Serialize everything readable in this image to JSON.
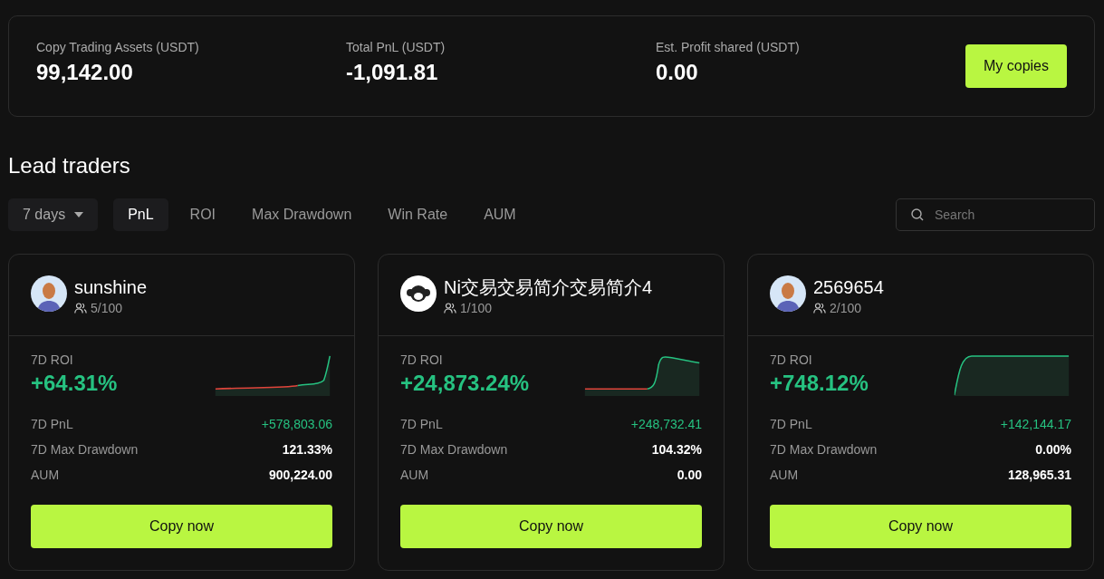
{
  "summary": {
    "stats": [
      {
        "label": "Copy Trading Assets (USDT)",
        "value": "99,142.00"
      },
      {
        "label": "Total PnL (USDT)",
        "value": "-1,091.81"
      },
      {
        "label": "Est. Profit shared (USDT)",
        "value": "0.00"
      }
    ],
    "button": "My copies"
  },
  "section_title": "Lead traders",
  "period": "7 days",
  "tabs": [
    {
      "label": "PnL",
      "selected": true
    },
    {
      "label": "ROI",
      "selected": false
    },
    {
      "label": "Max Drawdown",
      "selected": false
    },
    {
      "label": "Win Rate",
      "selected": false
    },
    {
      "label": "AUM",
      "selected": false
    }
  ],
  "search": {
    "placeholder": "Search"
  },
  "traders": [
    {
      "name": "sunshine",
      "avatar": {
        "kind": "person"
      },
      "followers": "5/100",
      "roi_label": "7D ROI",
      "roi": "+64.31%",
      "sparkline": {
        "kind": "late-spike"
      },
      "stats": [
        {
          "label": "7D PnL",
          "value": "+578,803.06",
          "positive": true
        },
        {
          "label": "7D Max Drawdown",
          "value": "121.33%",
          "positive": false
        },
        {
          "label": "AUM",
          "value": "900,224.00",
          "positive": false
        }
      ],
      "button": "Copy now"
    },
    {
      "name": "Ni交易交易简介交易简介4",
      "avatar": {
        "kind": "mascot"
      },
      "followers": "1/100",
      "roi_label": "7D ROI",
      "roi": "+24,873.24%",
      "sparkline": {
        "kind": "step-decline"
      },
      "stats": [
        {
          "label": "7D PnL",
          "value": "+248,732.41",
          "positive": true
        },
        {
          "label": "7D Max Drawdown",
          "value": "104.32%",
          "positive": false
        },
        {
          "label": "AUM",
          "value": "0.00",
          "positive": false
        }
      ],
      "button": "Copy now"
    },
    {
      "name": "2569654",
      "avatar": {
        "kind": "person"
      },
      "followers": "2/100",
      "roi_label": "7D ROI",
      "roi": "+748.12%",
      "sparkline": {
        "kind": "step-plateau"
      },
      "stats": [
        {
          "label": "7D PnL",
          "value": "+142,144.17",
          "positive": true
        },
        {
          "label": "7D Max Drawdown",
          "value": "0.00%",
          "positive": false
        },
        {
          "label": "AUM",
          "value": "128,965.31",
          "positive": false
        }
      ],
      "button": "Copy now"
    }
  ]
}
